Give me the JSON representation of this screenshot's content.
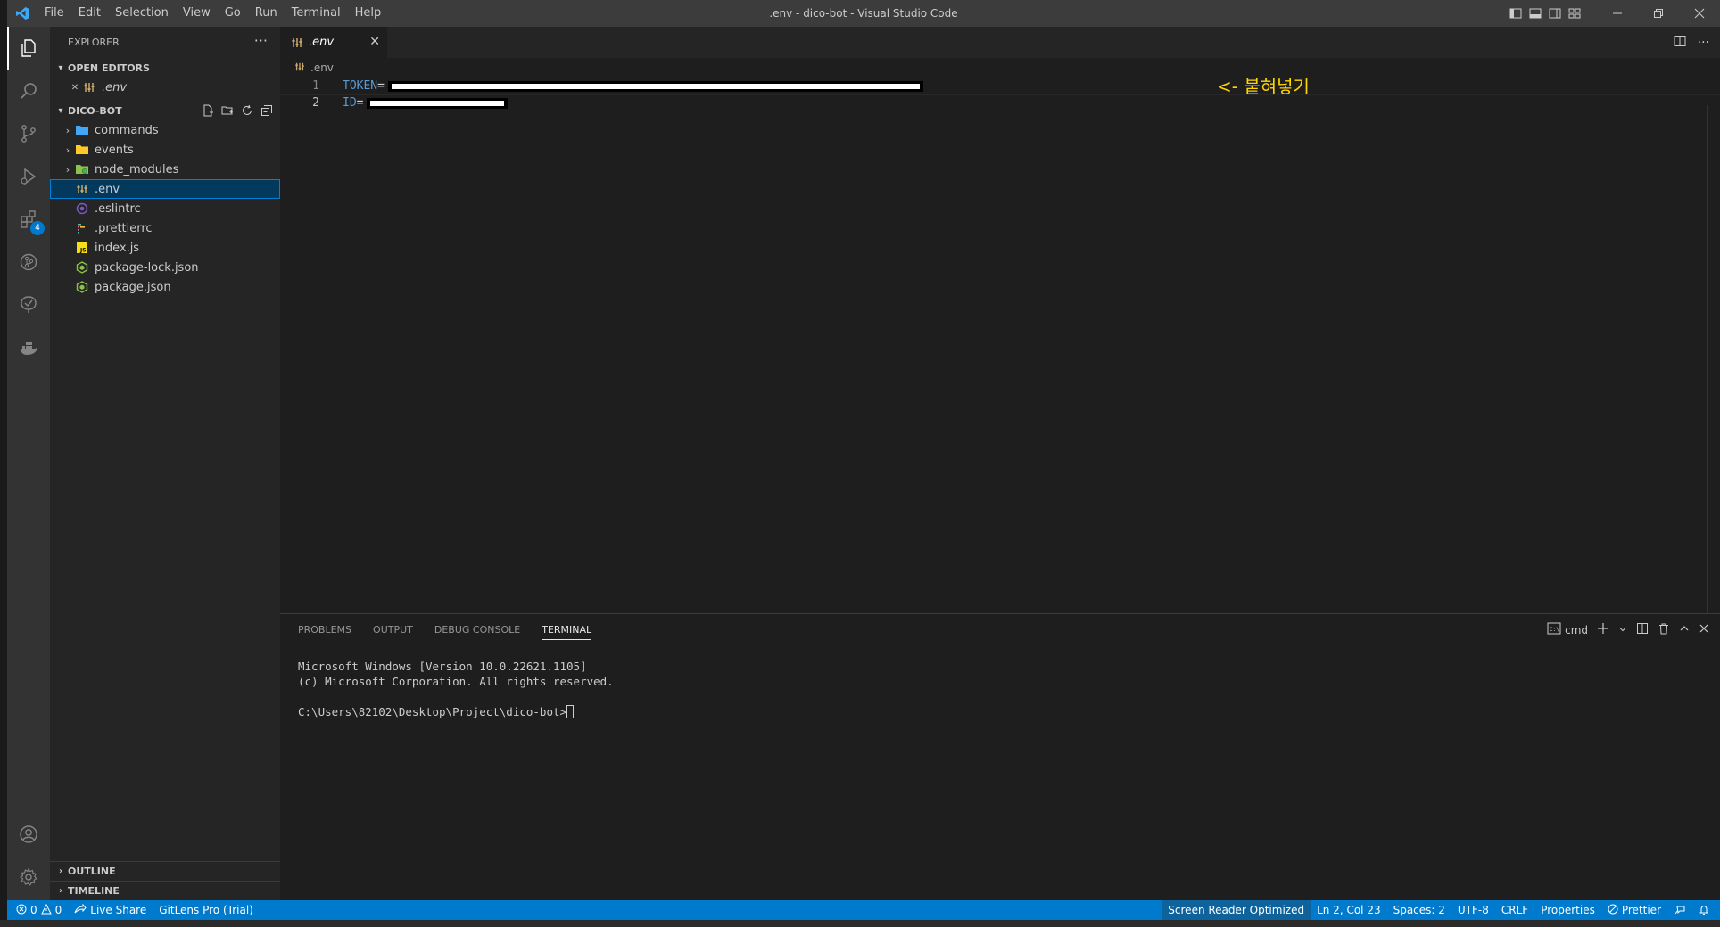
{
  "window": {
    "title": ".env - dico-bot - Visual Studio Code",
    "menu": [
      "File",
      "Edit",
      "Selection",
      "View",
      "Go",
      "Run",
      "Terminal",
      "Help"
    ]
  },
  "activity": {
    "extensions_badge": "4"
  },
  "sidebar": {
    "title": "EXPLORER",
    "more": "···",
    "open_editors_label": "OPEN EDITORS",
    "open_editors": [
      {
        "name": ".env",
        "close": "✕"
      }
    ],
    "project_label": "DICO-BOT",
    "tree": [
      {
        "name": "commands",
        "type": "folder",
        "color": "#42a5f5"
      },
      {
        "name": "events",
        "type": "folder",
        "color": "#ffca28"
      },
      {
        "name": "node_modules",
        "type": "folder",
        "color": "#8bc34a"
      },
      {
        "name": ".env",
        "type": "file"
      },
      {
        "name": ".eslintrc",
        "type": "file"
      },
      {
        "name": ".prettierrc",
        "type": "file"
      },
      {
        "name": "index.js",
        "type": "file"
      },
      {
        "name": "package-lock.json",
        "type": "file"
      },
      {
        "name": "package.json",
        "type": "file"
      }
    ],
    "outline_label": "OUTLINE",
    "timeline_label": "TIMELINE"
  },
  "editor": {
    "tab_label": ".env",
    "tab_close": "✕",
    "breadcrumb": ".env",
    "lines": [
      {
        "number": "1",
        "key": "TOKEN",
        "eq": "="
      },
      {
        "number": "2",
        "key": "ID",
        "eq": "="
      }
    ],
    "annotation": "<- 붙혀넣기"
  },
  "panel": {
    "tabs": [
      "PROBLEMS",
      "OUTPUT",
      "DEBUG CONSOLE",
      "TERMINAL"
    ],
    "active_tab": "TERMINAL",
    "shell": "cmd",
    "terminal_lines": [
      "Microsoft Windows [Version 10.0.22621.1105]",
      "(c) Microsoft Corporation. All rights reserved.",
      "",
      "C:\\Users\\82102\\Desktop\\Project\\dico-bot>"
    ]
  },
  "statusbar": {
    "errors": "0",
    "warnings": "0",
    "live_share": "Live Share",
    "gitlens": "GitLens Pro (Trial)",
    "screen_reader": "Screen Reader Optimized",
    "position": "Ln 2, Col 23",
    "spaces": "Spaces: 2",
    "encoding": "UTF-8",
    "eol": "CRLF",
    "language": "Properties",
    "prettier": "Prettier"
  }
}
